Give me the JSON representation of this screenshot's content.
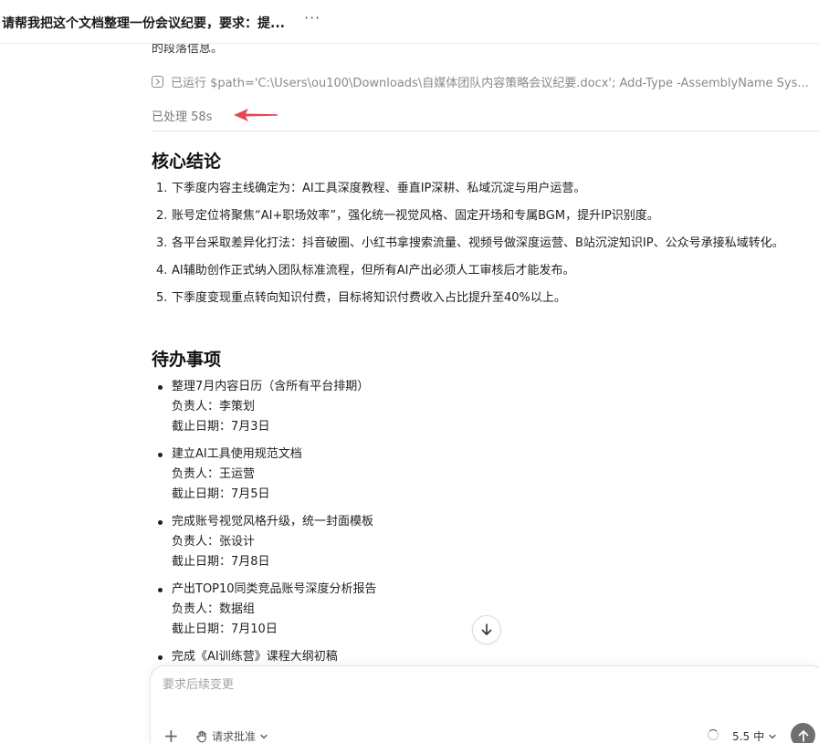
{
  "header": {
    "title": "请帮我把这个文档整理一份会议纪要，要求：提...",
    "more_label": "···"
  },
  "clipped_line": "的段落信息。",
  "command": {
    "text": "已运行 $path='C:\\Users\\ou100\\Downloads\\自媒体团队内容策略会议纪要.docx'; Add-Type -AssemblyName Sys..."
  },
  "status": {
    "processed": "已处理 58s",
    "arrow_color": "#e8474f"
  },
  "conclusions": {
    "heading": "核心结论",
    "items": [
      {
        "num": "1.",
        "text": "下季度内容主线确定为：AI工具深度教程、垂直IP深耕、私域沉淀与用户运营。"
      },
      {
        "num": "2.",
        "text": "账号定位将聚焦“AI+职场效率”，强化统一视觉风格、固定开场和专属BGM，提升IP识别度。"
      },
      {
        "num": "3.",
        "text": "各平台采取差异化打法：抖音破圈、小红书拿搜索流量、视频号做深度运营、B站沉淀知识IP、公众号承接私域转化。"
      },
      {
        "num": "4.",
        "text": "AI辅助创作正式纳入团队标准流程，但所有AI产出必须人工审核后才能发布。"
      },
      {
        "num": "5.",
        "text": "下季度变现重点转向知识付费，目标将知识付费收入占比提升至40%以上。"
      }
    ]
  },
  "todos": {
    "heading": "待办事项",
    "items": [
      {
        "task": "整理7月内容日历（含所有平台排期）",
        "owner": "负责人：李策划",
        "due": "截止日期：7月3日"
      },
      {
        "task": "建立AI工具使用规范文档",
        "owner": "负责人：王运营",
        "due": "截止日期：7月5日"
      },
      {
        "task": "完成账号视觉风格升级，统一封面模板",
        "owner": "负责人：张设计",
        "due": "截止日期：7月8日"
      },
      {
        "task": "产出TOP10同类竞品账号深度分析报告",
        "owner": "负责人：数据组",
        "due": "截止日期：7月10日"
      },
      {
        "task": "完成《AI训练营》课程大纲初稿",
        "owner": "",
        "due": ""
      }
    ]
  },
  "composer": {
    "placeholder": "要求后续变更",
    "plus_label": "+",
    "approval_label": "请求批准",
    "model_version": "5.5",
    "model_level": "中"
  }
}
